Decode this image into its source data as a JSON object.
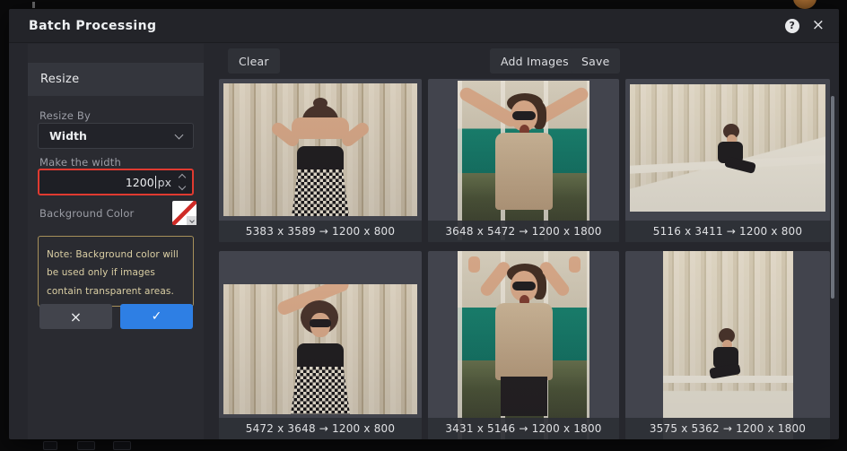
{
  "header": {
    "title": "Batch Processing",
    "help_glyph": "?",
    "close_glyph": "×"
  },
  "panel": {
    "section_title": "Resize",
    "resize_by_label": "Resize By",
    "resize_by_value": "Width",
    "width_label": "Make the width",
    "width_value": "1200",
    "width_unit": "px",
    "background_color_label": "Background Color",
    "note_text": "Note: Background color will be used only if images contain transparent areas.",
    "cancel_glyph": "×",
    "confirm_glyph": "✓"
  },
  "toolbar": {
    "clear_label": "Clear",
    "add_images_label": "Add Images",
    "save_label": "Save"
  },
  "images": [
    {
      "caption": "5383 x 3589 → 1200 x 800"
    },
    {
      "caption": "3648 x 5472 → 1200 x 1800"
    },
    {
      "caption": "5116 x 3411 → 1200 x 800"
    },
    {
      "caption": "5472 x 3648 → 1200 x 800"
    },
    {
      "caption": "3431 x 5146 → 1200 x 1800"
    },
    {
      "caption": "3575 x 5362 → 1200 x 1800"
    }
  ],
  "colors": {
    "accent_blue": "#2e7fe4",
    "input_alert_red": "#e03a30",
    "note_gold": "#a6905a",
    "dialog_bg": "#26272d",
    "tile_bg": "#42444d"
  }
}
